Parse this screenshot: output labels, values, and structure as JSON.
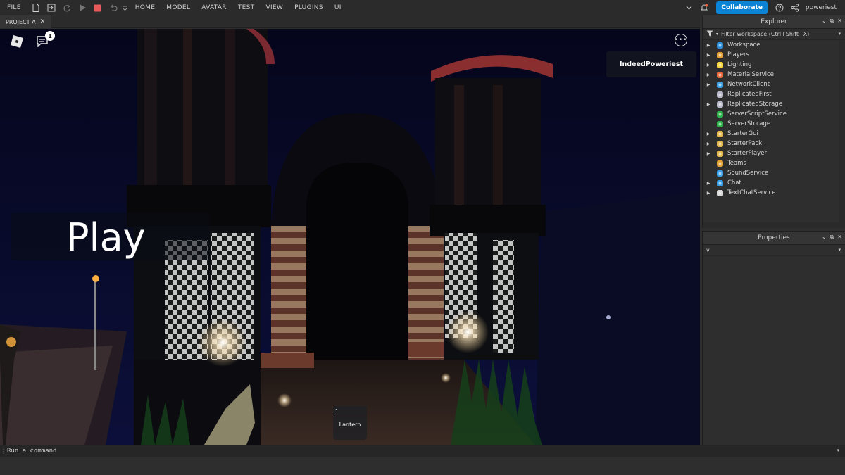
{
  "menu": {
    "file": "FILE",
    "items": [
      "HOME",
      "MODEL",
      "AVATAR",
      "TEST",
      "VIEW",
      "PLUGINS",
      "UI"
    ]
  },
  "topright": {
    "collaborate": "Collaborate",
    "username": "poweriest"
  },
  "tab": {
    "label": "PROJECT A",
    "close": "✕"
  },
  "viewport": {
    "chat_badge": "1",
    "more": "•••",
    "player_name": "IndeedPoweriest",
    "play_label": "Play",
    "hotbar": {
      "slot": "1",
      "item": "Lantern"
    }
  },
  "explorer": {
    "title": "Explorer",
    "filter_placeholder": "Filter workspace (Ctrl+Shift+X)",
    "items": [
      {
        "label": "Workspace",
        "expandable": true,
        "icon": "workspace-icon",
        "color": "#2c8fd9"
      },
      {
        "label": "Players",
        "expandable": true,
        "icon": "players-icon",
        "color": "#e4a133"
      },
      {
        "label": "Lighting",
        "expandable": true,
        "icon": "lighting-icon",
        "color": "#f5d33a"
      },
      {
        "label": "MaterialService",
        "expandable": true,
        "icon": "materialservice-icon",
        "color": "#e86a3a"
      },
      {
        "label": "NetworkClient",
        "expandable": true,
        "icon": "networkclient-icon",
        "color": "#3aa0e8"
      },
      {
        "label": "ReplicatedFirst",
        "expandable": false,
        "icon": "replicatedfirst-icon",
        "color": "#b8b8c8"
      },
      {
        "label": "ReplicatedStorage",
        "expandable": true,
        "icon": "replicatedstorage-icon",
        "color": "#b8b8c8"
      },
      {
        "label": "ServerScriptService",
        "expandable": false,
        "icon": "serverscriptservice-icon",
        "color": "#2db34a"
      },
      {
        "label": "ServerStorage",
        "expandable": false,
        "icon": "serverstorage-icon",
        "color": "#2db34a"
      },
      {
        "label": "StarterGui",
        "expandable": true,
        "icon": "startergui-icon",
        "color": "#e4b84a"
      },
      {
        "label": "StarterPack",
        "expandable": true,
        "icon": "starterpack-icon",
        "color": "#e4b84a"
      },
      {
        "label": "StarterPlayer",
        "expandable": true,
        "icon": "starterplayer-icon",
        "color": "#e4b84a"
      },
      {
        "label": "Teams",
        "expandable": false,
        "icon": "teams-icon",
        "color": "#e4a133"
      },
      {
        "label": "SoundService",
        "expandable": false,
        "icon": "soundservice-icon",
        "color": "#3aa0e8"
      },
      {
        "label": "Chat",
        "expandable": true,
        "icon": "chat-service-icon",
        "color": "#3aa0e8"
      },
      {
        "label": "TextChatService",
        "expandable": true,
        "icon": "textchatservice-icon",
        "color": "#d8d8d8"
      }
    ]
  },
  "properties": {
    "title": "Properties",
    "filter_value": "v"
  },
  "command": {
    "placeholder": "Run a command"
  }
}
